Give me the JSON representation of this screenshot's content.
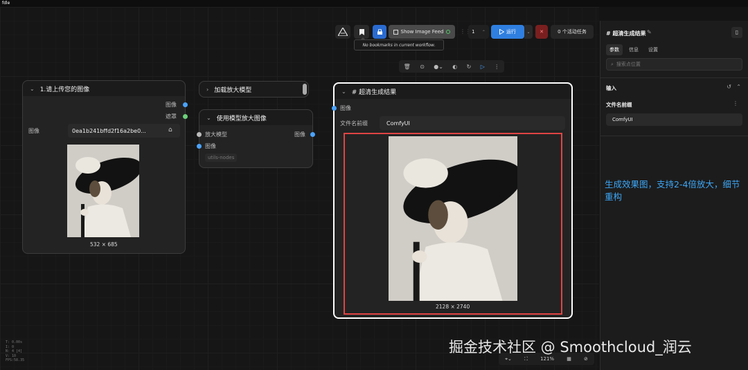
{
  "window": {
    "title": "fdle"
  },
  "toolbar": {
    "show_image_feed": "Show Image Feed",
    "queue_count": "1",
    "run_label": "运行",
    "active_tasks": "0 个活动任务",
    "bookmark_tooltip": "No bookmarks in current workflow."
  },
  "nodes": {
    "upload": {
      "title": "1.请上传您的图像",
      "out_image": "图像",
      "out_mask": "遮罩",
      "field_label": "图像",
      "file_value": "0ea1b241bffd2f16a2be0...",
      "dims": "532 × 685"
    },
    "load_model": {
      "title": "加载放大模型"
    },
    "upscale": {
      "title": "使用模型放大图像",
      "in_model": "放大模型",
      "in_image": "图像",
      "out_image": "图像",
      "badge": "utils-nodes"
    },
    "result": {
      "title": "# 超清生成结果",
      "in_image": "图像",
      "prefix_label": "文件名前缀",
      "prefix_value": "ComfyUI",
      "dims": "2128 × 2740"
    }
  },
  "sidebar": {
    "title": "# 超清生成结果",
    "tabs": [
      "参数",
      "信息",
      "设置"
    ],
    "search_placeholder": "搜索点位置",
    "section_input": "输入",
    "field_label": "文件名前缀",
    "field_value": "ComfyUI"
  },
  "annotation": "生成效果图，支持2-4倍放大，细节重构",
  "zoom": "121%",
  "debug_lines": [
    "T: 0.00s",
    "I: 0",
    "N: 4 [4]",
    "V: 10",
    "FPS:58.35"
  ],
  "watermark": "掘金技术社区 @ Smoothcloud_润云",
  "colors": {
    "accent": "#2f7fe0",
    "highlight": "#e04444",
    "annotation": "#3da6f5"
  }
}
